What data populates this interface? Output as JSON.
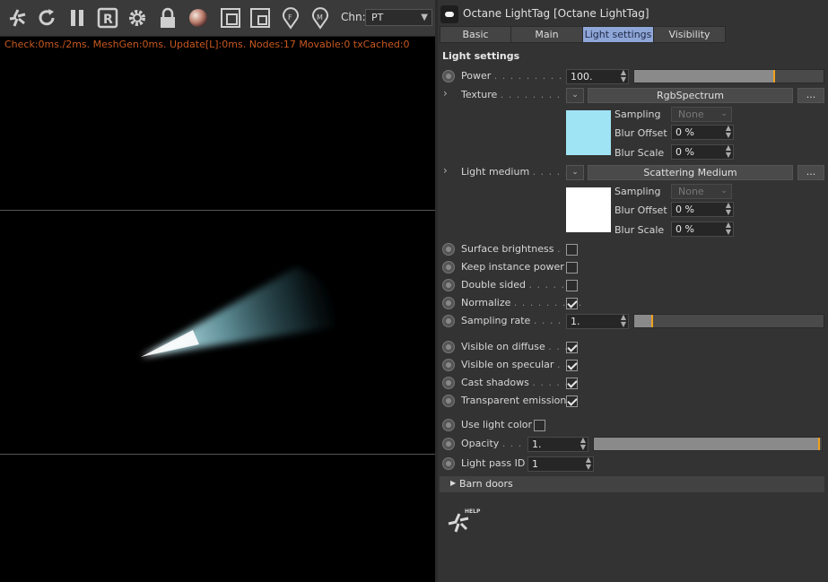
{
  "viewer": {
    "toolbar_icons": [
      "octane-logo-icon",
      "refresh-icon",
      "pause-icon",
      "r-icon",
      "gear-icon",
      "lock-icon",
      "sphere-icon",
      "region-icon",
      "film-region-icon",
      "focus-pick-icon",
      "material-pick-icon"
    ],
    "channel_label": "Chn:",
    "channel_value": "PT",
    "stats": "Check:0ms./2ms. MeshGen:0ms. Update[L]:0ms. Nodes:17 Movable:0 txCached:0"
  },
  "panel": {
    "title": "Octane LightTag [Octane LightTag]",
    "tabs": [
      "Basic",
      "Main",
      "Light settings",
      "Visibility"
    ],
    "active_tab": "Light settings",
    "section_title": "Light settings",
    "power": {
      "label": "Power",
      "value": "100.",
      "slider_fraction": 0.74
    },
    "texture": {
      "label": "Texture",
      "shader": "RgbSpectrum",
      "more": "...",
      "swatch_color": "#9ee4f5",
      "sampling_label": "Sampling",
      "sampling_value": "None",
      "blur_offset_label": "Blur Offset",
      "blur_offset_value": "0 %",
      "blur_scale_label": "Blur Scale",
      "blur_scale_value": "0 %"
    },
    "light_medium": {
      "label": "Light medium",
      "shader": "Scattering Medium",
      "more": "...",
      "swatch_color": "#ffffff",
      "sampling_label": "Sampling",
      "sampling_value": "None",
      "blur_offset_label": "Blur Offset",
      "blur_offset_value": "0 %",
      "blur_scale_label": "Blur Scale",
      "blur_scale_value": "0 %"
    },
    "checks1": [
      {
        "label": "Surface brightness",
        "checked": false
      },
      {
        "label": "Keep instance power",
        "checked": false
      },
      {
        "label": "Double sided",
        "checked": false
      },
      {
        "label": "Normalize",
        "checked": true
      }
    ],
    "sampling_rate": {
      "label": "Sampling rate",
      "value": "1.",
      "slider_fraction": 0.09
    },
    "checks2": [
      {
        "label": "Visible on diffuse",
        "checked": true
      },
      {
        "label": "Visible on specular",
        "checked": true
      },
      {
        "label": "Cast shadows",
        "checked": true
      },
      {
        "label": "Transparent emission",
        "checked": true
      }
    ],
    "use_light_color": {
      "label": "Use light color",
      "checked": false
    },
    "opacity": {
      "label": "Opacity",
      "value": "1.",
      "slider_fraction": 1.0
    },
    "light_pass_id": {
      "label": "Light pass ID",
      "value": "1"
    },
    "barn_doors": "Barn doors",
    "help_text": "HELP"
  },
  "colors": {
    "accent_orange": "#f0a020",
    "active_tab": "#8fa6d8",
    "stats_text": "#c8581f"
  }
}
